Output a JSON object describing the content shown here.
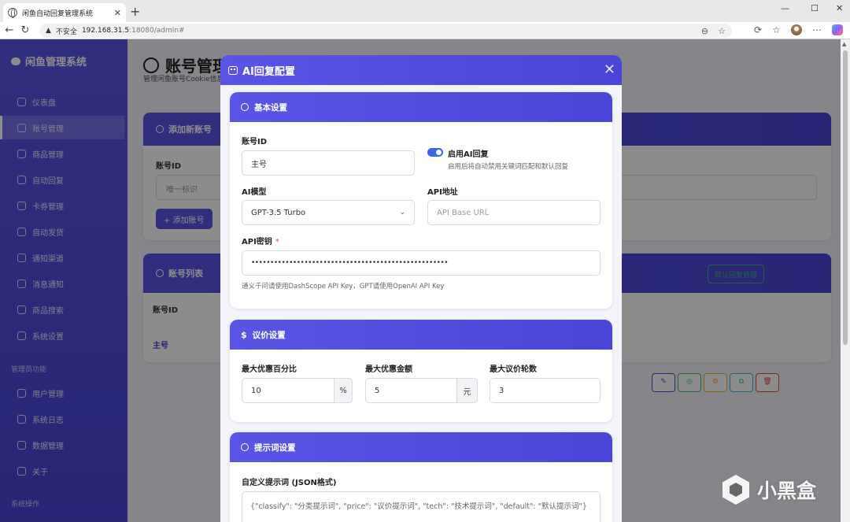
{
  "browser": {
    "tab_title": "闲鱼自动回复管理系统",
    "url_warning": "不安全",
    "url_host": "192.168.31.5",
    "url_path": ":18080/admin#"
  },
  "sidebar": {
    "brand": "闲鱼管理系统",
    "items": [
      {
        "label": "仪表盘"
      },
      {
        "label": "账号管理"
      },
      {
        "label": "商品管理"
      },
      {
        "label": "自动回复"
      },
      {
        "label": "卡券管理"
      },
      {
        "label": "自动发货"
      },
      {
        "label": "通知渠道"
      },
      {
        "label": "消息通知"
      },
      {
        "label": "商品搜索"
      },
      {
        "label": "系统设置"
      }
    ],
    "admin_group": "管理员功能",
    "admin_items": [
      {
        "label": "用户管理"
      },
      {
        "label": "系统日志"
      },
      {
        "label": "数据管理"
      },
      {
        "label": "关于"
      }
    ],
    "more_group": "系统操作"
  },
  "main": {
    "title": "账号管理",
    "subtitle": "管理闲鱼账号Cookie信息",
    "add_card_title": "添加新账号",
    "account_id_label": "账号ID",
    "account_id_placeholder": "唯一标识",
    "add_button": "+ 添加账号",
    "list_card_title": "账号列表",
    "default_reply_button": "默认回复管理",
    "col_account_id": "账号ID",
    "row_account": "主号"
  },
  "modal": {
    "title": "AI回复配置",
    "basic": {
      "title": "基本设置",
      "account_id_label": "账号ID",
      "account_id_value": "主号",
      "enable_label": "启用AI回复",
      "enable_help": "启用后将自动禁用关键词匹配和默认回复",
      "model_label": "AI模型",
      "model_value": "GPT-3.5 Turbo",
      "api_url_label": "API地址",
      "api_url_placeholder": "API Base URL",
      "api_key_label": "API密钥",
      "api_key_required": "*",
      "api_key_value": "••••••••••••••••••••••••••••••••••••••••••••••••••••",
      "api_key_help": "通义千问请使用DashScope API Key，GPT请使用OpenAI API Key"
    },
    "bargain": {
      "title": "议价设置",
      "max_percent_label": "最大优惠百分比",
      "max_percent_value": "10",
      "max_percent_unit": "%",
      "max_amount_label": "最大优惠金额",
      "max_amount_value": "5",
      "max_amount_unit": "元",
      "max_rounds_label": "最大议价轮数",
      "max_rounds_value": "3"
    },
    "prompt": {
      "title": "提示词设置",
      "custom_label": "自定义提示词 (JSON格式)",
      "custom_placeholder": "{\"classify\": \"分类提示词\", \"price\": \"议价提示词\", \"tech\": \"技术提示词\", \"default\": \"默认提示词\"}"
    }
  },
  "watermark": "小黑盒"
}
